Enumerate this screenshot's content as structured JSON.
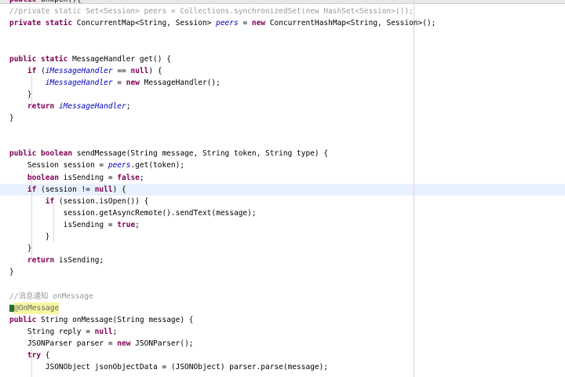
{
  "editor": {
    "lines": [
      {
        "parts": [
          {
            "c": "kw",
            "t": "public"
          },
          {
            "c": "",
            "t": " "
          },
          {
            "c": "",
            "t": "onOpen"
          },
          {
            "c": "",
            "t": "("
          },
          {
            "c": "",
            "t": "){"
          }
        ]
      },
      {
        "parts": [
          {
            "c": "cmgray",
            "t": "//private static Set<Session> peers = Collections.synchronizedSet(new HashSet<Session>());"
          }
        ]
      },
      {
        "parts": [
          {
            "c": "kw",
            "t": "private static"
          },
          {
            "c": "",
            "t": " ConcurrentMap<String, Session> "
          },
          {
            "c": "st",
            "t": "peers"
          },
          {
            "c": "",
            "t": " = "
          },
          {
            "c": "kw",
            "t": "new"
          },
          {
            "c": "",
            "t": " ConcurrentHashMap<String, Session>();"
          }
        ]
      },
      {
        "parts": [
          {
            "c": "",
            "t": ""
          }
        ]
      },
      {
        "parts": [
          {
            "c": "",
            "t": ""
          }
        ]
      },
      {
        "parts": [
          {
            "c": "kw",
            "t": "public static"
          },
          {
            "c": "",
            "t": " MessageHandler get() {"
          }
        ]
      },
      {
        "parts": [
          {
            "c": "",
            "t": "    "
          },
          {
            "c": "kw",
            "t": "if"
          },
          {
            "c": "",
            "t": " ("
          },
          {
            "c": "st",
            "t": "iMessageHandler"
          },
          {
            "c": "",
            "t": " == "
          },
          {
            "c": "kw",
            "t": "null"
          },
          {
            "c": "",
            "t": ") {"
          }
        ]
      },
      {
        "parts": [
          {
            "c": "",
            "t": "        "
          },
          {
            "c": "st",
            "t": "iMessageHandler"
          },
          {
            "c": "",
            "t": " = "
          },
          {
            "c": "kw",
            "t": "new"
          },
          {
            "c": "",
            "t": " MessageHandler();"
          }
        ]
      },
      {
        "parts": [
          {
            "c": "",
            "t": "    }"
          }
        ]
      },
      {
        "parts": [
          {
            "c": "",
            "t": "    "
          },
          {
            "c": "kw",
            "t": "return"
          },
          {
            "c": "",
            "t": " "
          },
          {
            "c": "st",
            "t": "iMessageHandler"
          },
          {
            "c": "",
            "t": ";"
          }
        ]
      },
      {
        "parts": [
          {
            "c": "",
            "t": "}"
          }
        ]
      },
      {
        "parts": [
          {
            "c": "",
            "t": ""
          }
        ]
      },
      {
        "parts": [
          {
            "c": "",
            "t": ""
          }
        ]
      },
      {
        "parts": [
          {
            "c": "kw",
            "t": "public boolean"
          },
          {
            "c": "",
            "t": " sendMessage(String message, String token, String type) {"
          }
        ]
      },
      {
        "parts": [
          {
            "c": "",
            "t": "    Session session = "
          },
          {
            "c": "st",
            "t": "peers"
          },
          {
            "c": "",
            "t": ".get(token);"
          }
        ]
      },
      {
        "parts": [
          {
            "c": "",
            "t": "    "
          },
          {
            "c": "kw",
            "t": "boolean"
          },
          {
            "c": "",
            "t": " isSending = "
          },
          {
            "c": "kw",
            "t": "false"
          },
          {
            "c": "",
            "t": ";"
          }
        ]
      },
      {
        "parts": [
          {
            "c": "",
            "t": "    "
          },
          {
            "c": "kw",
            "t": "if"
          },
          {
            "c": "",
            "t": " (session != "
          },
          {
            "c": "kw",
            "t": "null"
          },
          {
            "c": "",
            "t": ") {"
          }
        ]
      },
      {
        "parts": [
          {
            "c": "",
            "t": "        "
          },
          {
            "c": "kw",
            "t": "if"
          },
          {
            "c": "",
            "t": " (session.isOpen()) {"
          }
        ]
      },
      {
        "parts": [
          {
            "c": "",
            "t": "            session.getAsyncRemote().sendText(message);"
          }
        ]
      },
      {
        "parts": [
          {
            "c": "",
            "t": "            isSending = "
          },
          {
            "c": "kw",
            "t": "true"
          },
          {
            "c": "",
            "t": ";"
          }
        ]
      },
      {
        "parts": [
          {
            "c": "",
            "t": "        }"
          }
        ]
      },
      {
        "parts": [
          {
            "c": "",
            "t": "    }"
          }
        ]
      },
      {
        "parts": [
          {
            "c": "",
            "t": "    "
          },
          {
            "c": "kw",
            "t": "return"
          },
          {
            "c": "",
            "t": " isSending;"
          }
        ]
      },
      {
        "parts": [
          {
            "c": "",
            "t": "}"
          }
        ]
      },
      {
        "parts": [
          {
            "c": "",
            "t": ""
          }
        ]
      },
      {
        "parts": [
          {
            "c": "cmgray",
            "t": "//消息通知 onMessage"
          }
        ]
      },
      {
        "parts": [
          {
            "c": "anno",
            "t": "@OnMessage"
          }
        ]
      },
      {
        "parts": [
          {
            "c": "kw",
            "t": "public"
          },
          {
            "c": "",
            "t": " String onMessage(String message) {"
          }
        ]
      },
      {
        "parts": [
          {
            "c": "",
            "t": "    String reply = "
          },
          {
            "c": "kw",
            "t": "null"
          },
          {
            "c": "",
            "t": ";"
          }
        ]
      },
      {
        "parts": [
          {
            "c": "",
            "t": "    JSONParser parser = "
          },
          {
            "c": "kw",
            "t": "new"
          },
          {
            "c": "",
            "t": " JSONParser();"
          }
        ]
      },
      {
        "parts": [
          {
            "c": "",
            "t": "    "
          },
          {
            "c": "kw",
            "t": "try"
          },
          {
            "c": "",
            "t": " {"
          }
        ]
      },
      {
        "parts": [
          {
            "c": "",
            "t": "        JSONObject jsonObjectData = (JSONObject) parser.parse(message);"
          }
        ]
      }
    ]
  }
}
